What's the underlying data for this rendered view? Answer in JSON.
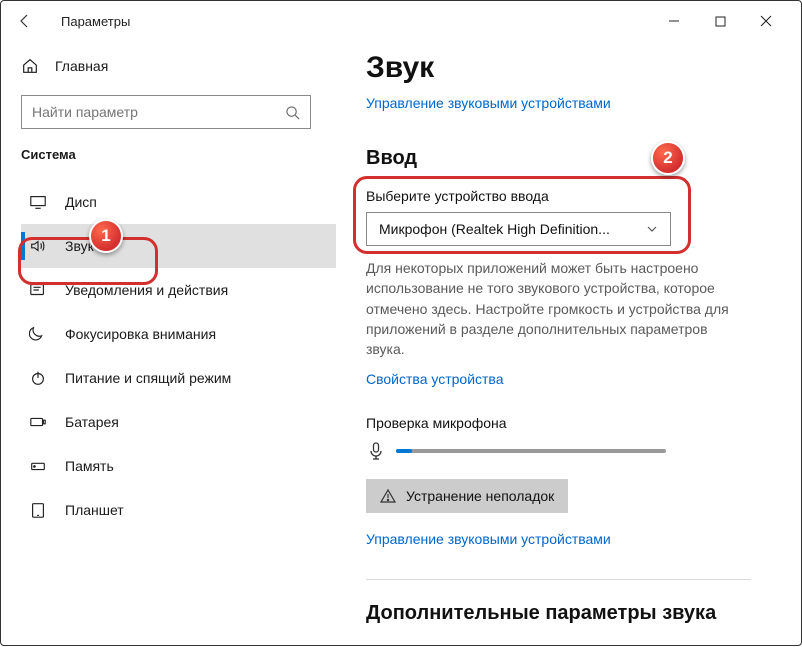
{
  "titlebar": {
    "title": "Параметры"
  },
  "sidebar": {
    "home": "Главная",
    "search_placeholder": "Найти параметр",
    "category": "Система",
    "items": [
      {
        "label": "Дисп"
      },
      {
        "label": "Звук"
      },
      {
        "label": "Уведомления и действия"
      },
      {
        "label": "Фокусировка внимания"
      },
      {
        "label": "Питание и спящий режим"
      },
      {
        "label": "Батарея"
      },
      {
        "label": "Память"
      },
      {
        "label": "Планшет"
      }
    ]
  },
  "main": {
    "title": "Звук",
    "manage_link": "Управление звуковыми устройствами",
    "input_heading": "Ввод",
    "input_label": "Выберите устройство ввода",
    "input_value": "Микрофон (Realtek High Definition...",
    "hint": "Для некоторых приложений может быть настроено использование не того звукового устройства, которое отмечено здесь. Настройте громкость и устройства для приложений в разделе дополнительных параметров звука.",
    "props_link": "Свойства устройства",
    "test_label": "Проверка микрофона",
    "trouble_btn": "Устранение неполадок",
    "manage_link2": "Управление звуковыми устройствами",
    "advanced_heading": "Дополнительные параметры звука"
  },
  "callouts": {
    "n1": "1",
    "n2": "2"
  }
}
